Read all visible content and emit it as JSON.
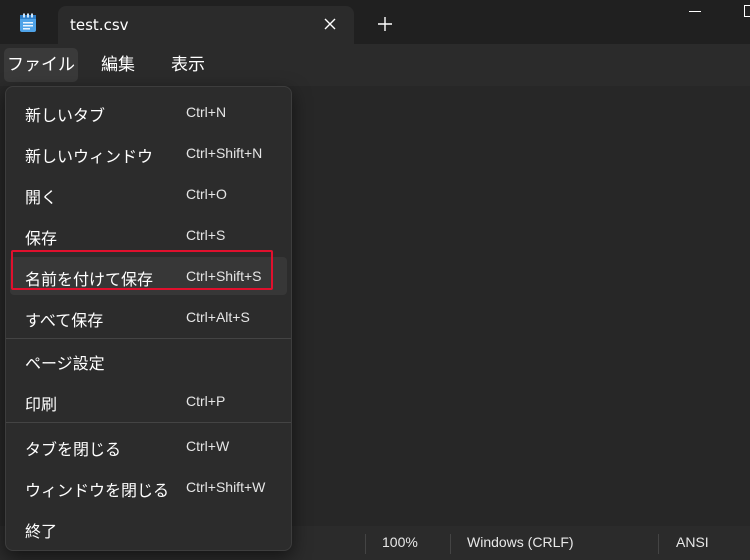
{
  "app": {
    "icon": "notepad-icon",
    "tab_title": "test.csv",
    "close_icon": "close-icon",
    "new_tab_icon": "plus-icon"
  },
  "menubar": {
    "file": "ファイル",
    "edit": "編集",
    "view": "表示"
  },
  "file_menu": {
    "items": [
      {
        "label": "新しいタブ",
        "shortcut": "Ctrl+N"
      },
      {
        "label": "新しいウィンドウ",
        "shortcut": "Ctrl+Shift+N"
      },
      {
        "label": "開く",
        "shortcut": "Ctrl+O"
      },
      {
        "label": "保存",
        "shortcut": "Ctrl+S"
      },
      {
        "label": "名前を付けて保存",
        "shortcut": "Ctrl+Shift+S",
        "highlighted": true
      },
      {
        "label": "すべて保存",
        "shortcut": "Ctrl+Alt+S"
      },
      {
        "label": "ページ設定",
        "shortcut": ""
      },
      {
        "label": "印刷",
        "shortcut": "Ctrl+P"
      },
      {
        "label": "タブを閉じる",
        "shortcut": "Ctrl+W"
      },
      {
        "label": "ウィンドウを閉じる",
        "shortcut": "Ctrl+Shift+W"
      },
      {
        "label": "終了",
        "shortcut": ""
      }
    ]
  },
  "statusbar": {
    "zoom": "100%",
    "line_ending": "Windows (CRLF)",
    "encoding": "ANSI"
  },
  "colors": {
    "highlight_border": "#e0102d",
    "background": "#202020",
    "menu_background": "#2c2c2c"
  }
}
